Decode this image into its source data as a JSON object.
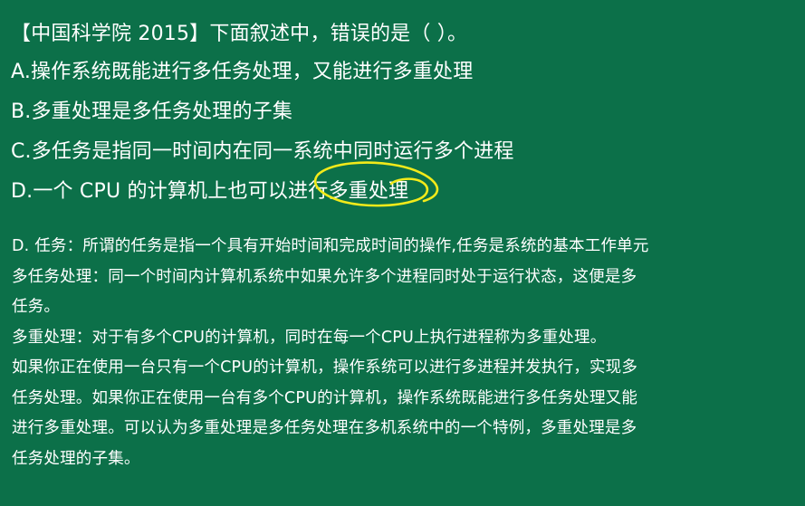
{
  "question": {
    "title": "【中国科学院 2015】下面叙述中，错误的是（ ）。",
    "options": [
      "A.操作系统既能进行多任务处理，又能进行多重处理",
      "B.多重处理是多任务处理的子集",
      "C.多任务是指同一时间内在同一系统中同时运行多个进程",
      "D.一个 CPU 的计算机上也可以进行多重处理"
    ]
  },
  "explanation": {
    "lines": [
      "D. 任务：所谓的任务是指一个具有开始时间和完成时间的操作,任务是系统的基本工作单元",
      "多任务处理：同一个时间内计算机系统中如果允许多个进程同时处于运行状态，这便是多",
      "任务。",
      "多重处理：对于有多个CPU的计算机，同时在每一个CPU上执行进程称为多重处理。",
      "如果你正在使用一台只有一个CPU的计算机，操作系统可以进行多进程并发执行，实现多",
      "任务处理。如果你正在使用一台有多个CPU的计算机，操作系统既能进行多任务处理又能",
      "进行多重处理。可以认为多重处理是多任务处理在多机系统中的一个特例，多重处理是多",
      "任务处理的子集。"
    ]
  },
  "colors": {
    "background": "#0c7049",
    "text": "#ffffff",
    "annotation": "#f2ea1a"
  }
}
